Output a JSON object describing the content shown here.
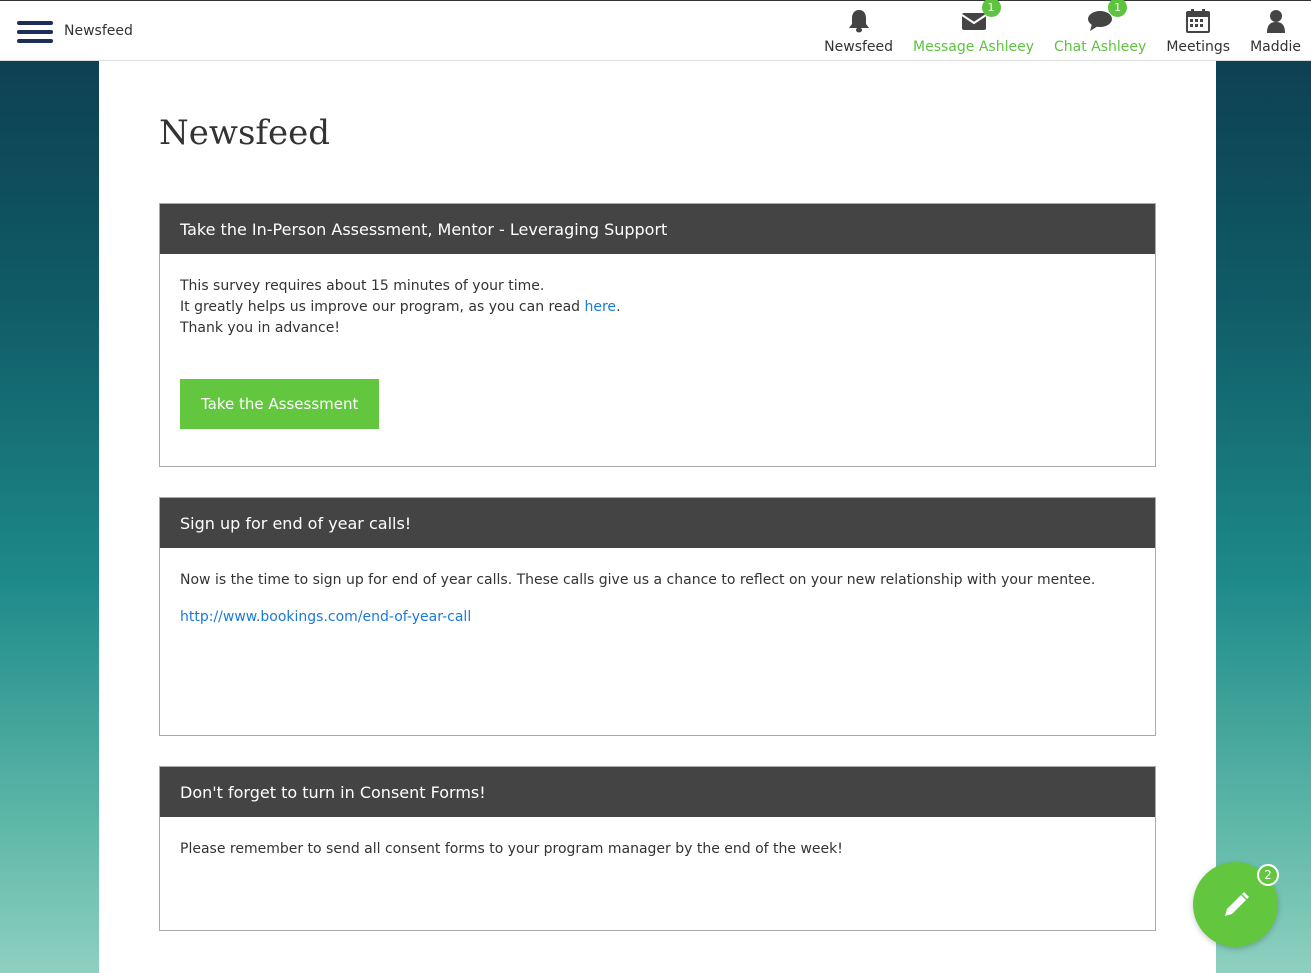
{
  "header": {
    "title": "Newsfeed",
    "nav": [
      {
        "label": "Newsfeed",
        "icon": "bell-icon"
      },
      {
        "label": "Message Ashleey",
        "icon": "envelope-icon",
        "badge": "1",
        "color": "#5ec33f"
      },
      {
        "label": "Chat Ashleey",
        "icon": "chat-bubble-icon",
        "badge": "1",
        "color": "#5ec33f"
      },
      {
        "label": "Meetings",
        "icon": "calendar-icon"
      },
      {
        "label": "Maddie",
        "icon": "user-icon"
      }
    ]
  },
  "main": {
    "title": "Newsfeed",
    "cards": [
      {
        "header": "Take the In-Person Assessment, Mentor - Leveraging Support",
        "line1": "This survey requires about 15 minutes of your time.",
        "line2_prefix": "It greatly helps us improve our program, as you can read ",
        "line2_link": "here",
        "line2_suffix": ".",
        "line3": "Thank you in advance!",
        "button": "Take the Assessment"
      },
      {
        "header": "Sign up for end of year calls!",
        "text": "Now is the time to sign up for end of year calls. These calls give us a chance to reflect on your new relationship with your mentee.",
        "link": "http://www.bookings.com/end-of-year-call"
      },
      {
        "header": "Don't forget to turn in Consent Forms!",
        "text": "Please remember to send all consent forms to your program manager by the end of the week!"
      }
    ]
  },
  "fab": {
    "badge": "2",
    "icon": "pencil-icon"
  },
  "colors": {
    "accent": "#63c63f",
    "card_header": "#444444",
    "link": "#1a7ad9",
    "nav_dark": "#1f2d5a"
  }
}
